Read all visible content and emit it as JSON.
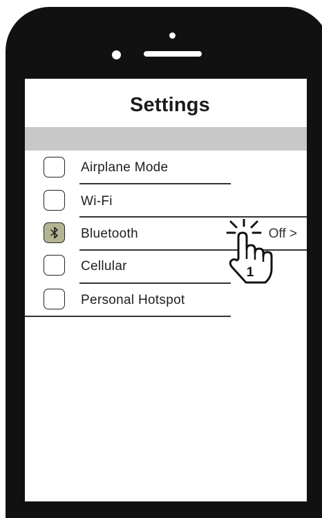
{
  "screen": {
    "title": "Settings",
    "items": [
      {
        "label": "Airplane Mode",
        "icon": "blank-checkbox",
        "selected": false
      },
      {
        "label": "Wi-Fi",
        "icon": "blank-checkbox",
        "selected": false
      },
      {
        "label": "Bluetooth",
        "icon": "bluetooth-icon",
        "selected": true,
        "value": "Off >"
      },
      {
        "label": "Cellular",
        "icon": "blank-checkbox",
        "selected": false
      },
      {
        "label": "Personal Hotspot",
        "icon": "blank-checkbox",
        "selected": false
      }
    ]
  },
  "annotation": {
    "step_number": "1",
    "icon": "tap-hand-icon"
  },
  "colors": {
    "device_frame": "#111111",
    "section_bar": "#c8c8c8",
    "active_checkbox": "#b4b492"
  }
}
